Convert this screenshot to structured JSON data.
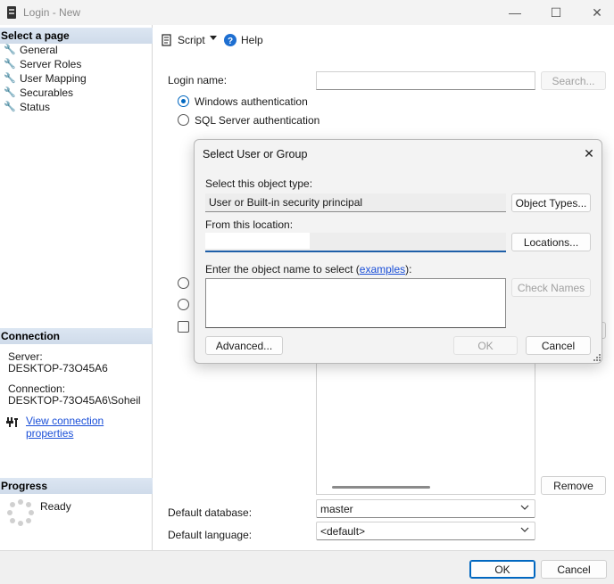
{
  "window": {
    "title": "Login - New",
    "minimize_glyph": "—",
    "maximize_glyph": "☐",
    "close_glyph": "✕"
  },
  "left_pane": {
    "select_page_header": "Select a page",
    "pages": [
      {
        "label": "General",
        "icon": "wrench-icon"
      },
      {
        "label": "Server Roles",
        "icon": "wrench-icon"
      },
      {
        "label": "User Mapping",
        "icon": "wrench-icon"
      },
      {
        "label": "Securables",
        "icon": "wrench-icon"
      },
      {
        "label": "Status",
        "icon": "wrench-icon"
      }
    ],
    "connection_header": "Connection",
    "server_label": "Server:",
    "server_value": "DESKTOP-73O45A6",
    "connection_label": "Connection:",
    "connection_value": "DESKTOP-73O45A6\\Soheil",
    "view_connection_properties": "View connection properties",
    "progress_header": "Progress",
    "progress_status": "Ready"
  },
  "toolbar": {
    "script_label": "Script",
    "help_label": "Help"
  },
  "general": {
    "login_name_label": "Login name:",
    "login_name_value": "",
    "search_button": "Search...",
    "windows_auth_label": "Windows authentication",
    "sql_auth_label": "SQL Server authentication",
    "remove_button": "Remove",
    "default_database_label": "Default database:",
    "default_database_value": "master",
    "default_language_label": "Default language:",
    "default_language_value": "<default>"
  },
  "footer": {
    "ok_button": "OK",
    "cancel_button": "Cancel"
  },
  "dialog": {
    "title": "Select User or Group",
    "close_glyph": "✕",
    "object_type_label": "Select this object type:",
    "object_type_value": "User or Built-in security principal",
    "object_types_button": "Object Types...",
    "location_label": "From this location:",
    "location_value": "",
    "locations_button": "Locations...",
    "object_name_label": "Enter the object name to select (",
    "examples_link": "examples",
    "object_name_label_end": "):",
    "object_name_value": "",
    "check_names_button": "Check Names",
    "advanced_button": "Advanced...",
    "ok_button": "OK",
    "cancel_button": "Cancel"
  },
  "colors": {
    "accent": "#0067c0",
    "link": "#1a4fd8",
    "header_bg": "#cfdbea"
  }
}
